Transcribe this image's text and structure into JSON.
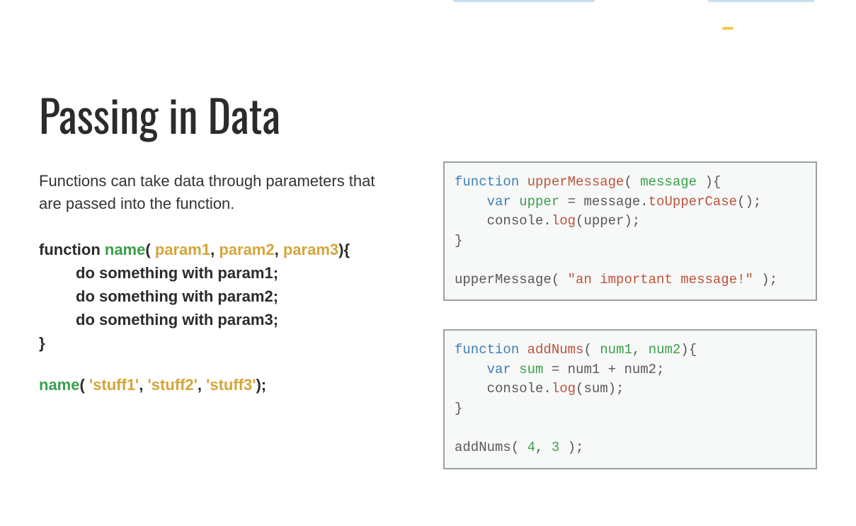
{
  "title": "Passing in Data",
  "description": "Functions can take data through parameters that are passed into the function.",
  "pseudo": {
    "keyword": "function ",
    "name": "name",
    "open": "( ",
    "p1": "param1",
    "sep1": ", ",
    "p2": "param2",
    "sep2": ", ",
    "p3": "param3",
    "close": "){",
    "body1": "do something with param1;",
    "body2": "do something with param2;",
    "body3": "do something with param3;",
    "end": "}"
  },
  "call": {
    "name": "name",
    "open": "( ",
    "a1": "'stuff1'",
    "sep1": ", ",
    "a2": "'stuff2'",
    "sep2": ", ",
    "a3": "'stuff3'",
    "close": ");"
  },
  "code1": {
    "l1a": "function ",
    "l1b": "upperMessage",
    "l1c": "( ",
    "l1d": "message",
    "l1e": " ){",
    "l2a": "    ",
    "l2b": "var ",
    "l2c": "upper",
    "l2d": " = message.",
    "l2e": "toUpperCase",
    "l2f": "();",
    "l3a": "    console.",
    "l3b": "log",
    "l3c": "(upper);",
    "l4": "}",
    "l5": "",
    "l6a": "upperMessage( ",
    "l6b": "\"an important message!\"",
    "l6c": " );"
  },
  "code2": {
    "l1a": "function ",
    "l1b": "addNums",
    "l1c": "( ",
    "l1d": "num1",
    "l1e": ", ",
    "l1f": "num2",
    "l1g": "){",
    "l2a": "    ",
    "l2b": "var ",
    "l2c": "sum",
    "l2d": " = num1 + num2;",
    "l3a": "    console.",
    "l3b": "log",
    "l3c": "(sum);",
    "l4": "}",
    "l5": "",
    "l6a": "addNums( ",
    "l6b": "4",
    "l6c": ", ",
    "l6d": "3",
    "l6e": " );"
  }
}
